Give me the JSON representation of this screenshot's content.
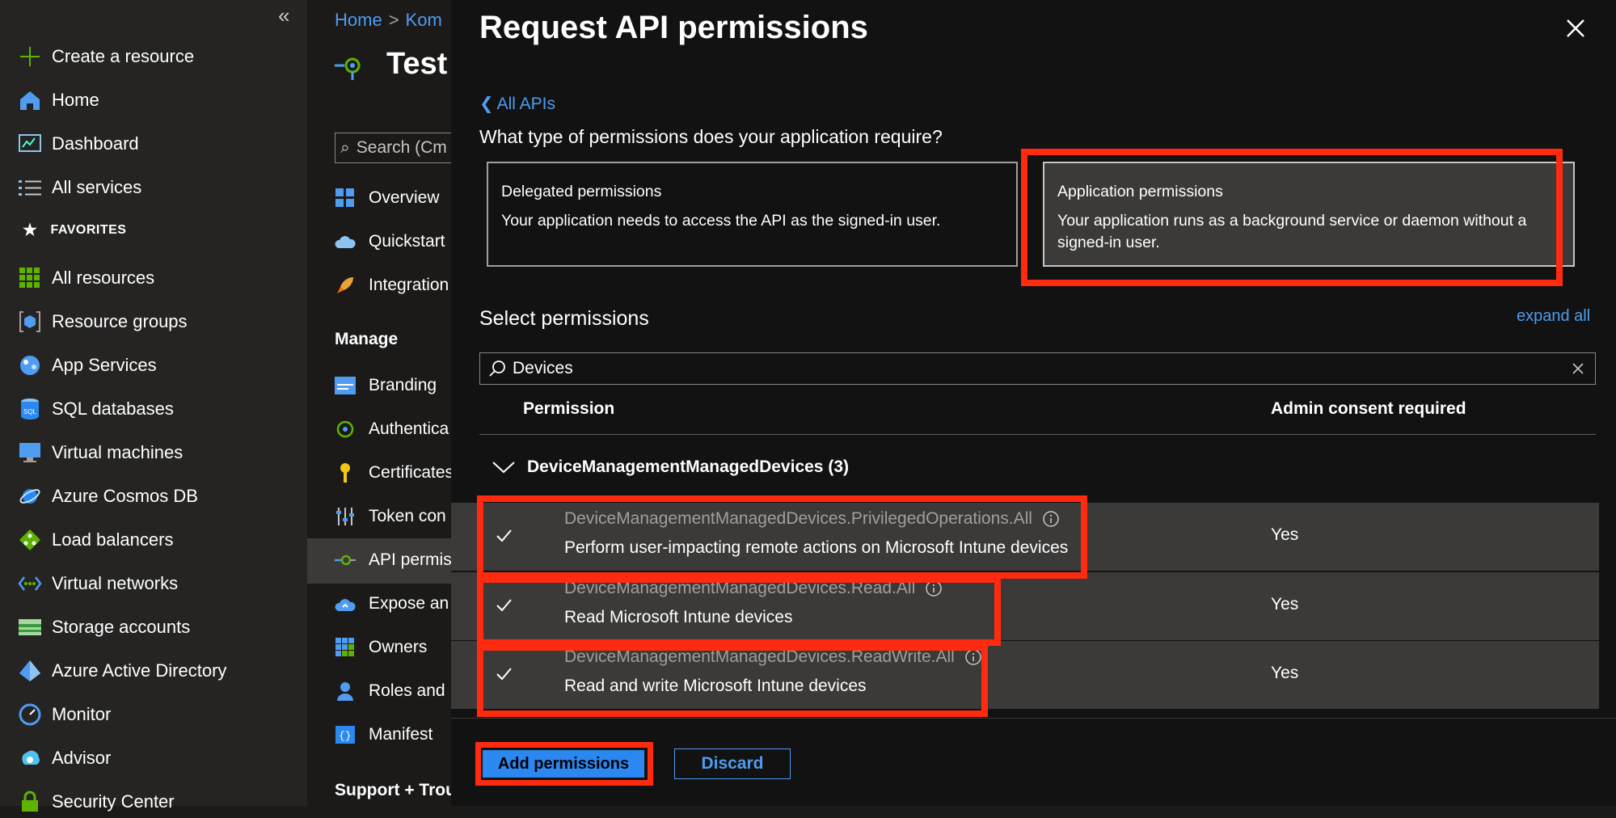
{
  "leftnav": {
    "collapse_glyph": "«",
    "create": "Create a resource",
    "home": "Home",
    "dashboard": "Dashboard",
    "all_services": "All services",
    "favorites": "FAVORITES",
    "items": [
      "All resources",
      "Resource groups",
      "App Services",
      "SQL databases",
      "Virtual machines",
      "Azure Cosmos DB",
      "Load balancers",
      "Virtual networks",
      "Storage accounts",
      "Azure Active Directory",
      "Monitor",
      "Advisor",
      "Security Center"
    ]
  },
  "blade": {
    "breadcrumb_home": "Home",
    "breadcrumb_next": "Kom",
    "breadcrumb_sep": ">",
    "app_title": "Test",
    "search_placeholder": "Search (Cm",
    "items_top": [
      "Overview",
      "Quickstart",
      "Integration"
    ],
    "manage_heading": "Manage",
    "items_manage": [
      "Branding",
      "Authentica",
      "Certificates",
      "Token con",
      "API permis",
      "Expose an",
      "Owners",
      "Roles and",
      "Manifest"
    ],
    "support_heading": "Support + Trou"
  },
  "panel": {
    "title": "Request API permissions",
    "back_link": "All APIs",
    "back_glyph": "❮",
    "question": "What type of permissions does your application require?",
    "delegated": {
      "title": "Delegated permissions",
      "desc": "Your application needs to access the API as the signed-in user."
    },
    "application": {
      "title": "Application permissions",
      "desc": "Your application runs as a background service or daemon without a signed-in user."
    },
    "select_title": "Select permissions",
    "expand_all": "expand all",
    "search_value": "Devices",
    "col_permission": "Permission",
    "col_admin": "Admin consent required",
    "group_name": "DeviceManagementManagedDevices (3)",
    "rows": [
      {
        "name": "DeviceManagementManagedDevices.PrivilegedOperations.All",
        "desc": "Perform user-impacting remote actions on Microsoft Intune devices",
        "admin": "Yes"
      },
      {
        "name": "DeviceManagementManagedDevices.Read.All",
        "desc": "Read Microsoft Intune devices",
        "admin": "Yes"
      },
      {
        "name": "DeviceManagementManagedDevices.ReadWrite.All",
        "desc": "Read and write Microsoft Intune devices",
        "admin": "Yes"
      }
    ],
    "add_button": "Add permissions",
    "discard_button": "Discard"
  },
  "colors": {
    "accent": "#4f9cf0",
    "highlight": "#ff2a0f",
    "primary_button": "#2b88f0"
  }
}
